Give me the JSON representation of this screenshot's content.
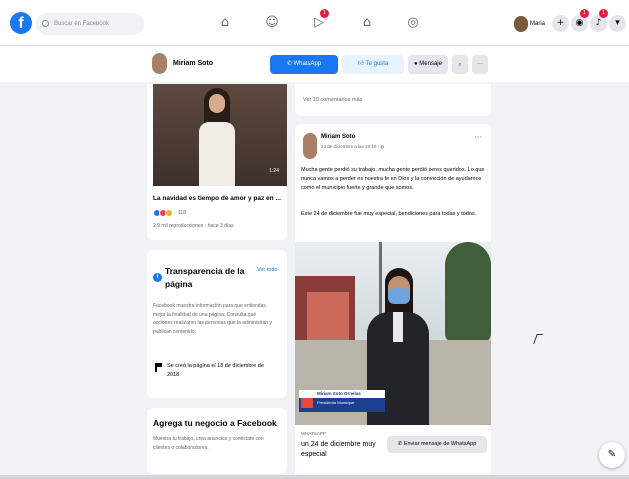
{
  "topbar": {
    "logo": "f",
    "search_placeholder": "Buscar en Facebook",
    "nav_icons": [
      "home-icon",
      "friends-icon",
      "watch-icon",
      "marketplace-icon",
      "groups-icon"
    ],
    "watch_badge": "1",
    "user_name": "Maria",
    "action_icons": {
      "create": "+",
      "messenger_badge": "1",
      "notifications_badge": "1",
      "menu": "▾"
    }
  },
  "page_header": {
    "name": "Miriam Soto",
    "whatsapp_label": "WhatsApp",
    "like_label": "Te gusta",
    "message_label": "Mensaje",
    "search_icon": "⌕",
    "more_icon": "···"
  },
  "video_card": {
    "duration": "1:24",
    "title": "La navidad es tiempo de amor y paz en ...",
    "reaction_count": "118",
    "views": "2,9 mil reproducciones · hace 3 días",
    "colors": {
      "like": "#1877f2",
      "love": "#f33e58",
      "haha": "#f7b125"
    }
  },
  "transparency": {
    "title": "Transparencia de la página",
    "see_all": "Ver todo",
    "body": "Facebook muestra información para que entiendas mejor la finalidad de una página. Consulta qué acciones realizaron las personas que la administran y publican contenido.",
    "created": "Se creó la página el 18 de diciembre de 2018"
  },
  "business": {
    "title": "Agrega tu negocio a Facebook",
    "body": "Muestra tu trabajo, crea anuncios y conéctate con clientes o colaboradores."
  },
  "prev_post": {
    "comments_link": "Ver 10 comentarios más"
  },
  "post": {
    "author": "Miriam Soto",
    "date": "24 de diciembre a las 19:40 · ",
    "more": "···",
    "paragraph1": "Mucha gente perdió su trabajo, mucha gente perdió seres queridos. Lo que nunca vamos a perder es nuestra fe en Dios y la convicción de ayudarnos como el municipio fuerte y grande que somos.",
    "paragraph2": "Este 24 de diciembre fue muy especial, bendiciones para todas y todos.",
    "lower_third_name": "Miriam Soto Ornelas",
    "lower_third_role": "Presidenta Municipal",
    "link_label": "WHATSAPP",
    "link_headline": "un 24 de diciembre muy especial",
    "whatsapp_button": "Enviar mensaje de WhatsApp"
  }
}
